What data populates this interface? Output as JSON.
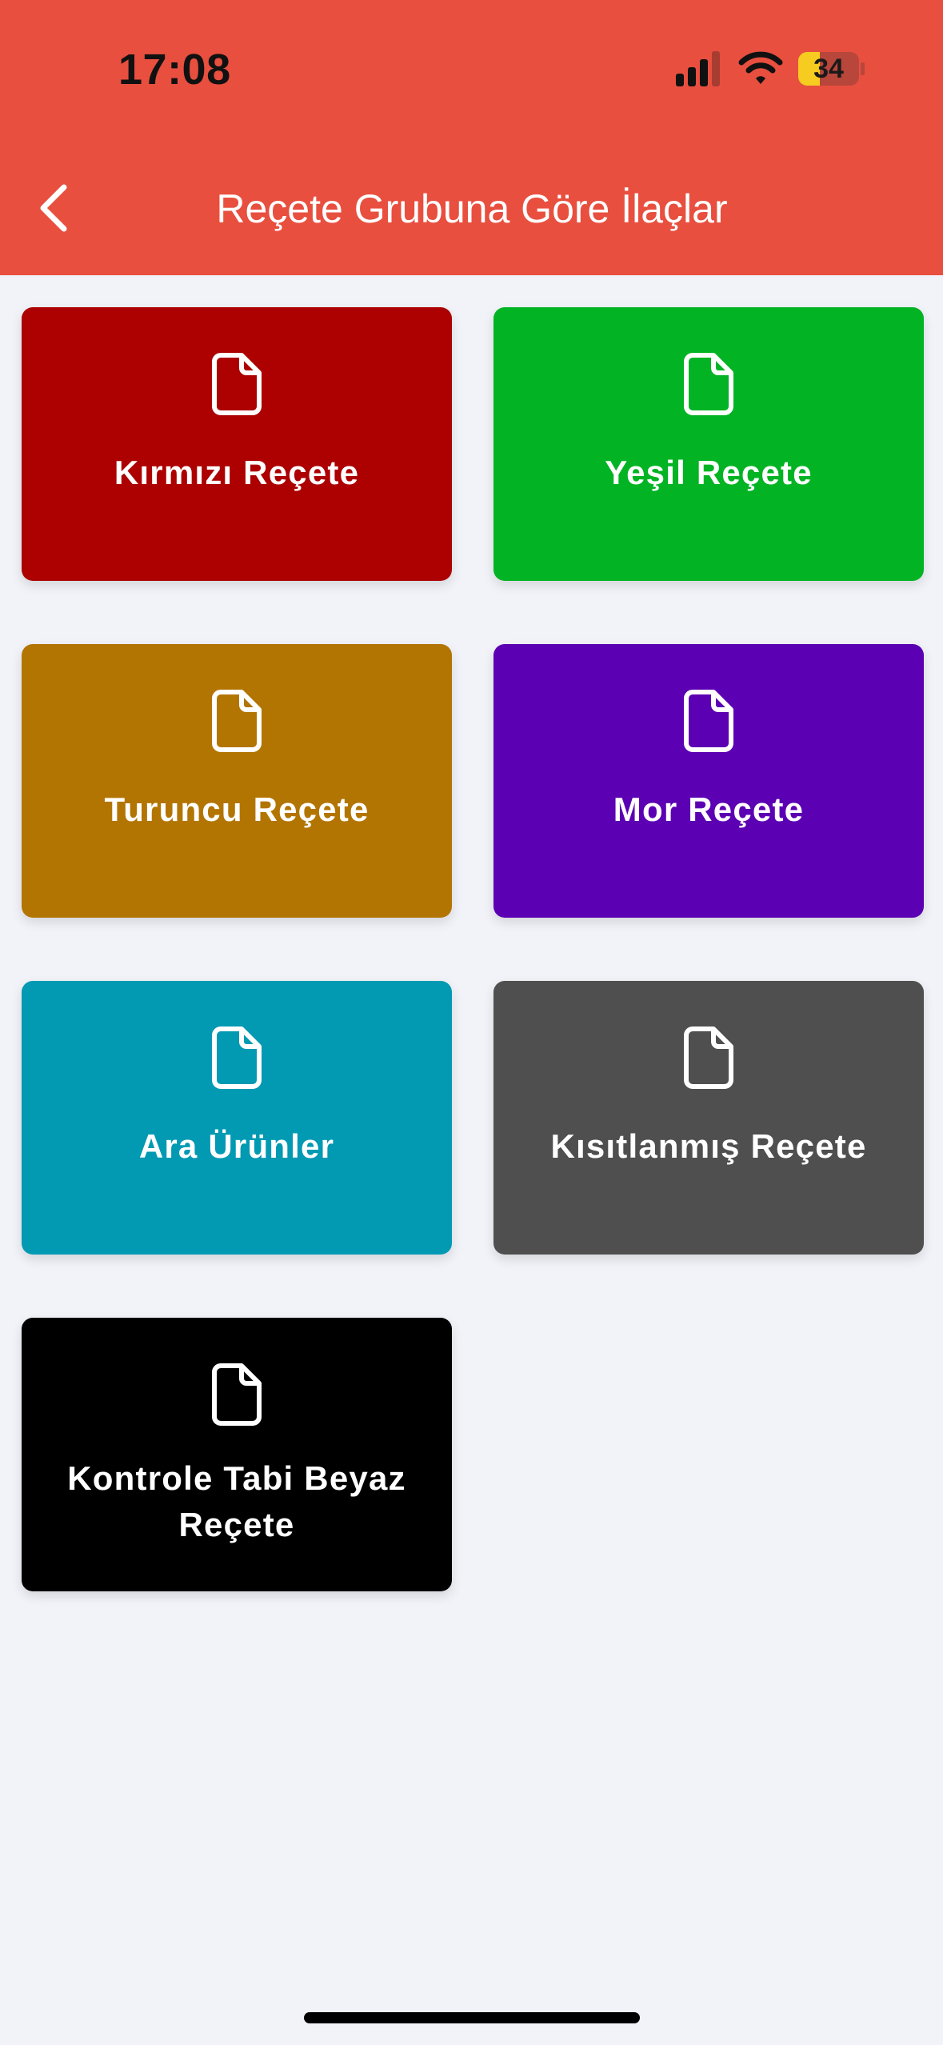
{
  "status_bar": {
    "time": "17:08",
    "battery_level": "34",
    "icons": [
      "signal-icon",
      "wifi-icon",
      "battery-icon"
    ]
  },
  "header": {
    "title": "Reçete Grubuna Göre İlaçlar",
    "back_icon": "chevron-left-icon",
    "color": "#e84f3f"
  },
  "cards": [
    {
      "label": "Kırmızı Reçete",
      "color": "#ad0000",
      "icon": "document-icon"
    },
    {
      "label": "Yeşil Reçete",
      "color": "#02b324",
      "icon": "document-icon"
    },
    {
      "label": "Turuncu Reçete",
      "color": "#b37502",
      "icon": "document-icon"
    },
    {
      "label": "Mor Reçete",
      "color": "#5b00b3",
      "icon": "document-icon"
    },
    {
      "label": "Ara Ürünler",
      "color": "#0299b3",
      "icon": "document-icon"
    },
    {
      "label": "Kısıtlanmış Reçete",
      "color": "#4f4f4f",
      "icon": "document-icon"
    },
    {
      "label": "Kontrole Tabi Beyaz Reçete",
      "color": "#000000",
      "icon": "document-icon"
    }
  ],
  "colors": {
    "background": "#f1f3f8",
    "card_text": "#ffffff"
  }
}
